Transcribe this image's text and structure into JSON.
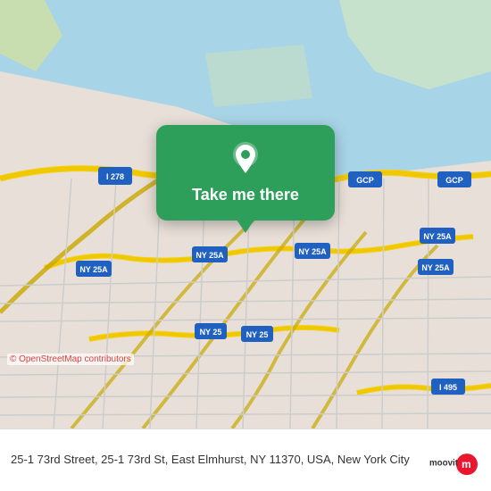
{
  "map": {
    "alt": "Street map of East Elmhurst, NY area",
    "popup": {
      "label": "Take me there"
    },
    "osm_credit": "© OpenStreetMap contributors"
  },
  "bottom_bar": {
    "address": "25-1 73rd Street, 25-1 73rd St, East Elmhurst, NY\n11370, USA, New York City"
  },
  "logo": {
    "alt": "moovit"
  }
}
